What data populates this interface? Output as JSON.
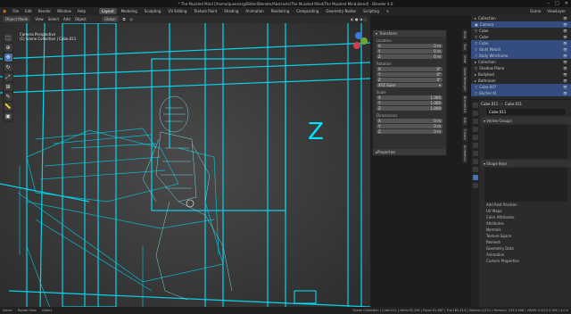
{
  "titlebar": {
    "title": "* The Muzzled Mind [/home/queenarg/Bilder/Blender/Abstracts/The Muzzled Mind/The Muzzled Mind.blend] - Blender 4.0",
    "buttons": [
      "minimize",
      "maximize",
      "close"
    ]
  },
  "menubar": {
    "items": [
      "File",
      "Edit",
      "Render",
      "Window",
      "Help"
    ],
    "workspaces": [
      "Layout",
      "Modeling",
      "Sculpting",
      "UV Editing",
      "Texture Paint",
      "Shading",
      "Animation",
      "Rendering",
      "Compositing",
      "Geometry Nodes",
      "Scripting",
      "+"
    ],
    "active_workspace": "Layout",
    "scene": "Scene",
    "view_layer": "ViewLayer"
  },
  "toolhdr": {
    "mode": "Object Mode",
    "menus": [
      "View",
      "Select",
      "Add",
      "Object"
    ],
    "orientation": "Global"
  },
  "viewport": {
    "info_line1": "Camera Perspective",
    "info_line2": "(1) Scene Collection | Cube.011",
    "accent": "#00e5ff"
  },
  "npanel": {
    "header": "Transform",
    "location_label": "Location",
    "location": [
      [
        "X",
        "0 m"
      ],
      [
        "Y",
        "0 m"
      ],
      [
        "Z",
        "0 m"
      ]
    ],
    "rotation_label": "Rotation",
    "rotation": [
      [
        "X",
        "0°"
      ],
      [
        "Y",
        "0°"
      ],
      [
        "Z",
        "0°"
      ]
    ],
    "mode": "XYZ Euler",
    "scale_label": "Scale",
    "scale": [
      [
        "X",
        "1.000"
      ],
      [
        "Y",
        "1.000"
      ],
      [
        "Z",
        "1.000"
      ]
    ],
    "dimensions_label": "Dimensions",
    "dimensions": [
      [
        "X",
        "0 m"
      ],
      [
        "Y",
        "0 m"
      ],
      [
        "Z",
        "0 m"
      ]
    ],
    "properties": "Properties"
  },
  "vtabs": [
    "Item",
    "Tool",
    "View",
    "Node Wrangler",
    "BlenderKit",
    "Edit",
    "Create",
    "Animation",
    "Node Wrangler",
    "MACHIN3",
    "Fluent",
    "BY-GEN",
    "3D-Print",
    "Screencast"
  ],
  "outliner": {
    "rows": [
      {
        "label": "Collection",
        "sel": false
      },
      {
        "label": "Camera",
        "sel": true
      },
      {
        "label": "Cube",
        "sel": false
      },
      {
        "label": "Cube",
        "sel": false
      },
      {
        "label": "Cube",
        "sel": true
      },
      {
        "label": "Stuhl Metall",
        "sel": true
      },
      {
        "label": "Body Wireframe",
        "sel": true
      },
      {
        "label": "Collection",
        "sel": false
      },
      {
        "label": "Shadow Plane",
        "sel": false
      },
      {
        "label": "Bodytext",
        "sel": false
      },
      {
        "label": "Bathroom",
        "sel": false
      },
      {
        "label": "Cube.007",
        "sel": true
      },
      {
        "label": "Bücher Kl",
        "sel": true
      }
    ]
  },
  "props": {
    "crumb_object": "Cube.011",
    "crumb_data": "Cube.011",
    "name_value": "Cube.011",
    "vertex_groups": "Vertex Groups",
    "shape_keys": "Shape Keys",
    "attributes": [
      "UV Maps",
      "Color Attributes",
      "Attributes",
      "Normals",
      "Texture Space",
      "Remesh",
      "Geometry Data",
      "Animation",
      "Custom Properties"
    ],
    "attr_header": "Add Rest Position"
  },
  "statusbar": {
    "left": [
      "Select",
      "Rotate View",
      "Object"
    ],
    "right": "Scene Collection | Cube.011 | Verts:95,194 | Faces:91,887 | Tris:182,414 | Objects:1/222 | Memory: 103.5 MiB | VRAM: 0.5/12.0 GiB | 4.0.0"
  }
}
